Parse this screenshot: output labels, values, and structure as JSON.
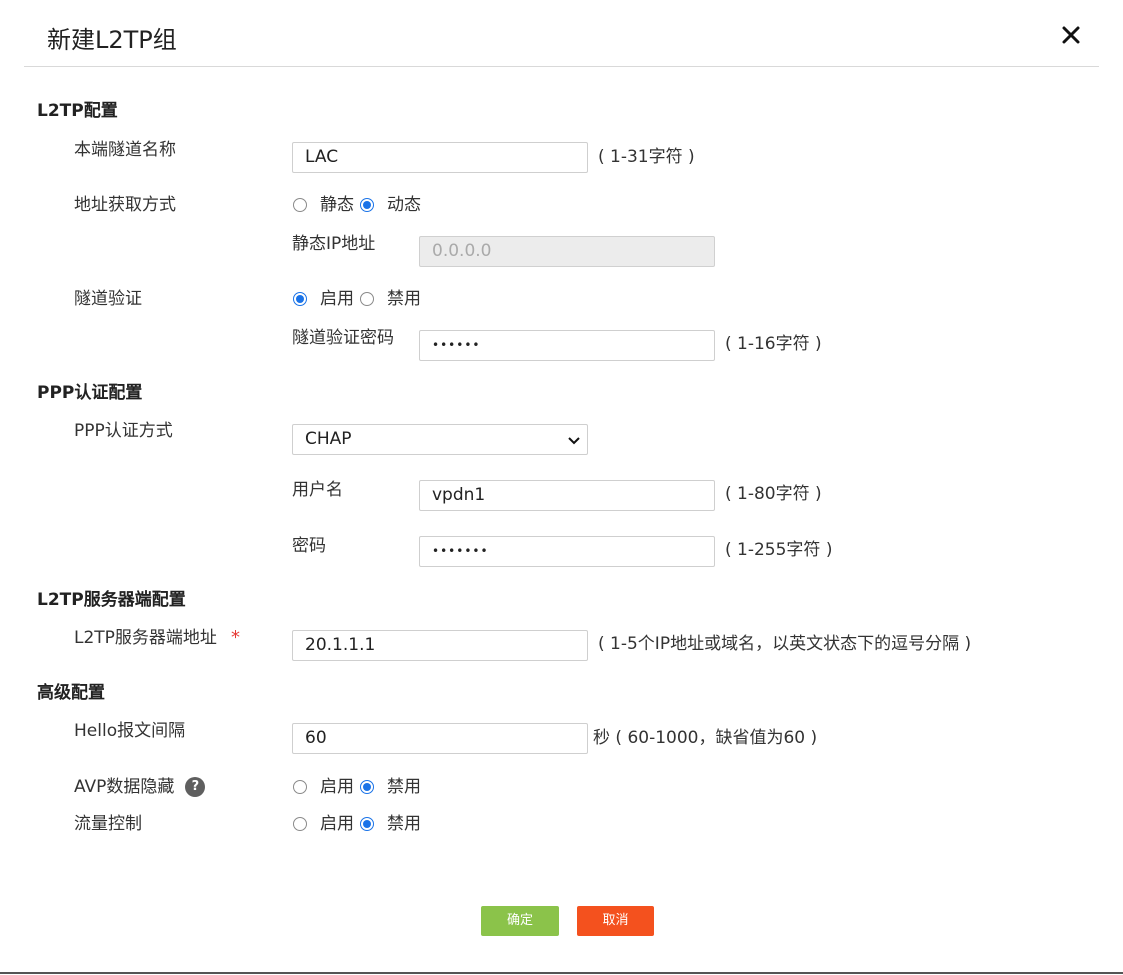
{
  "dialog": {
    "title": "新建L2TP组"
  },
  "l2tp": {
    "section": "L2TP配置",
    "tunnel_name_label": "本端隧道名称",
    "tunnel_name_value": "LAC",
    "tunnel_name_hint": "( 1-31字符 )",
    "addr_mode_label": "地址获取方式",
    "addr_static": "静态",
    "addr_dynamic": "动态",
    "static_ip_label": "静态IP地址",
    "static_ip_placeholder": "0.0.0.0",
    "tunnel_auth_label": "隧道验证",
    "auth_enable": "启用",
    "auth_disable": "禁用",
    "tunnel_pw_label": "隧道验证密码",
    "tunnel_pw_value": "••••••",
    "tunnel_pw_hint": "( 1-16字符 )"
  },
  "ppp": {
    "section": "PPP认证配置",
    "auth_mode_label": "PPP认证方式",
    "auth_mode_value": "CHAP",
    "username_label": "用户名",
    "username_value": "vpdn1",
    "username_hint": "( 1-80字符 )",
    "password_label": "密码",
    "password_value": "•••••••",
    "password_hint": "( 1-255字符 )"
  },
  "server": {
    "section": "L2TP服务器端配置",
    "addr_label": "L2TP服务器端地址",
    "required_mark": "*",
    "addr_value": "20.1.1.1",
    "addr_hint": "( 1-5个IP地址或域名，以英文状态下的逗号分隔 )"
  },
  "advanced": {
    "section": "高级配置",
    "hello_label": "Hello报文间隔",
    "hello_value": "60",
    "hello_hint": "秒 ( 60-1000，缺省值为60 )",
    "avp_label": "AVP数据隐藏",
    "help_glyph": "?",
    "enable": "启用",
    "disable": "禁用",
    "flow_label": "流量控制"
  },
  "buttons": {
    "ok": "确定",
    "cancel": "取消"
  },
  "colors": {
    "radio_accent": "#1a73e8",
    "ok_button": "#8bc34a",
    "cancel_button": "#f4511e",
    "required": "#e53935"
  }
}
